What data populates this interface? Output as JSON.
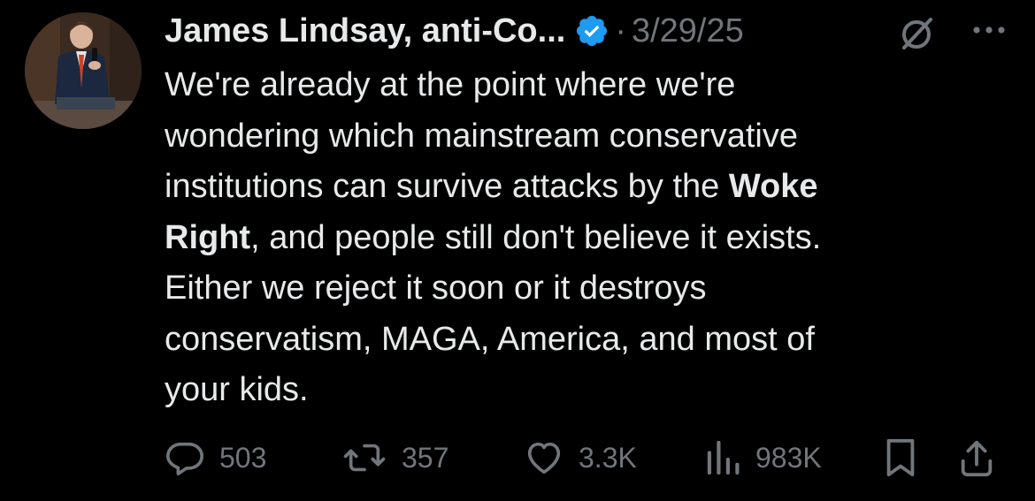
{
  "tweet": {
    "author_name": "James Lindsay, anti-Co...",
    "separator": "·",
    "date": "3/29/25",
    "text_lines": [
      {
        "pre": "We're already at the point where we're",
        "bold": "",
        "post": ""
      },
      {
        "pre": "wondering which mainstream conservative",
        "bold": "",
        "post": ""
      },
      {
        "pre": "institutions can survive attacks by the ",
        "bold": "Woke",
        "post": ""
      },
      {
        "pre": "",
        "bold": "Right",
        "post": ", and people still don't believe it exists."
      },
      {
        "pre": "Either we reject it soon or it destroys",
        "bold": "",
        "post": ""
      },
      {
        "pre": "conservatism, MAGA, America, and most of",
        "bold": "",
        "post": ""
      },
      {
        "pre": "your kids.",
        "bold": "",
        "post": ""
      }
    ]
  },
  "actions": {
    "replies": "503",
    "reposts": "357",
    "likes": "3.3K",
    "views": "983K"
  },
  "icons": {
    "verified": "verified-badge-icon",
    "grok": "grok-icon",
    "more": "more-icon",
    "reply": "reply-icon",
    "repost": "repost-icon",
    "like": "heart-icon",
    "views": "views-icon",
    "bookmark": "bookmark-icon",
    "share": "share-icon"
  },
  "colors": {
    "background": "#000000",
    "text": "#e7e9ea",
    "muted": "#71767b",
    "verified": "#1d9bf0"
  }
}
